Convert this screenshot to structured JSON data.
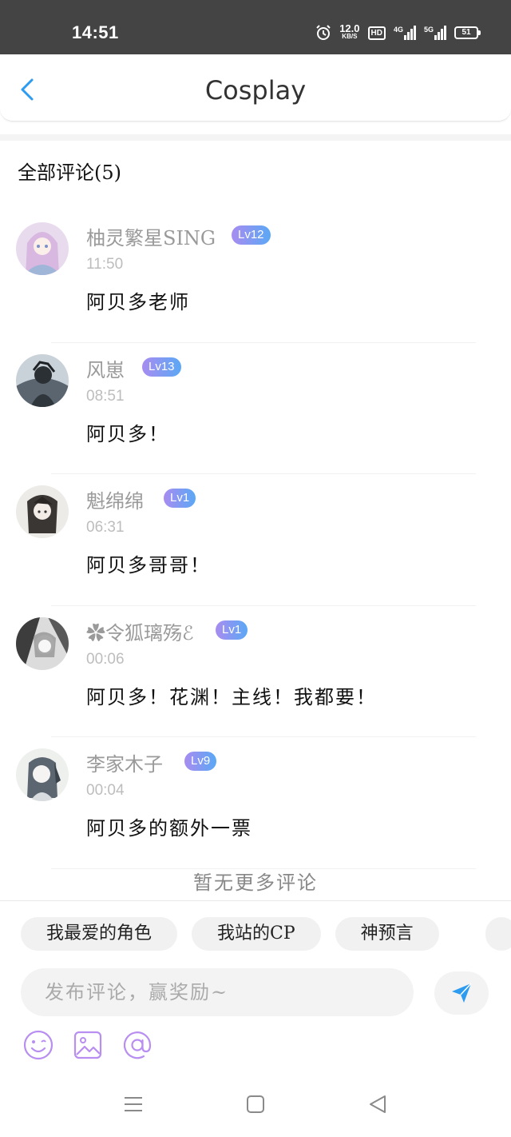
{
  "status_bar": {
    "time": "14:51",
    "speed_value": "12.0",
    "speed_unit": "KB/S",
    "hd_label": "HD",
    "net1_label": "4G",
    "net2_label": "5G",
    "battery": "51"
  },
  "header": {
    "title": "Cosplay"
  },
  "comments_section": {
    "title": "全部评论(5)",
    "comments": [
      {
        "name": "柚灵繁星SING",
        "level": "Lv12",
        "time": "11:50",
        "text": "阿贝多老师"
      },
      {
        "name": "风崽",
        "level": "Lv13",
        "time": "08:51",
        "text": "阿贝多！"
      },
      {
        "name": "魁绵绵",
        "level": "Lv1",
        "time": "06:31",
        "text": "阿贝多哥哥！"
      },
      {
        "name": "✿令狐璃殇ℰ",
        "level": "Lv1",
        "time": "00:06",
        "text": "阿贝多！花渊！主线！我都要！"
      },
      {
        "name": "李家木子",
        "level": "Lv9",
        "time": "00:04",
        "text": "阿贝多的额外一票"
      }
    ],
    "no_more": "暂无更多评论"
  },
  "composer": {
    "chips": [
      "我最爱的角色",
      "我站的CP",
      "神预言"
    ],
    "placeholder": "发布评论，赢奖励~",
    "tools": [
      "emoji-icon",
      "image-icon",
      "mention-icon"
    ]
  },
  "colors": {
    "accent_blue": "#2d9cf0",
    "tool_purple": "#b88ef0",
    "badge_start": "#a88cf0",
    "badge_end": "#5aa8f5"
  }
}
